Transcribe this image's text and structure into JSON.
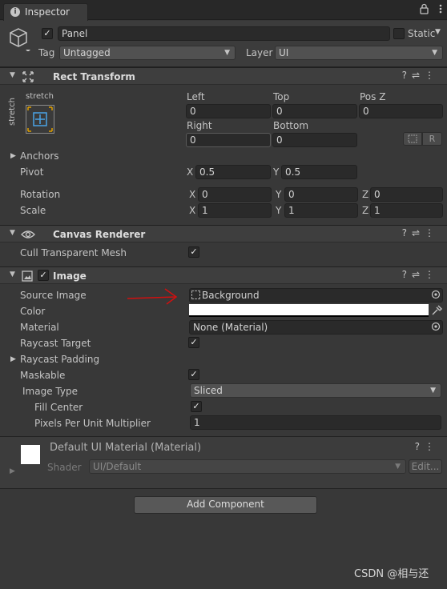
{
  "tab": {
    "label": "Inspector",
    "icons": [
      "lock-icon",
      "menu-icon"
    ]
  },
  "gameobject": {
    "active": true,
    "name": "Panel",
    "static_label": "Static",
    "tag_label": "Tag",
    "tag_value": "Untagged",
    "layer_label": "Layer",
    "layer_value": "UI"
  },
  "rect_transform": {
    "title": "Rect Transform",
    "stretch_top": "stretch",
    "stretch_side": "stretch",
    "left_label": "Left",
    "left_value": "0",
    "top_label": "Top",
    "top_value": "0",
    "posz_label": "Pos Z",
    "posz_value": "0",
    "right_label": "Right",
    "right_value": "0",
    "bottom_label": "Bottom",
    "bottom_value": "0",
    "r_button": "R",
    "anchors_label": "Anchors",
    "pivot_label": "Pivot",
    "pivot_x": "0.5",
    "pivot_y": "0.5",
    "rotation_label": "Rotation",
    "rot_x": "0",
    "rot_y": "0",
    "rot_z": "0",
    "scale_label": "Scale",
    "scale_x": "1",
    "scale_y": "1",
    "scale_z": "1",
    "x": "X",
    "y": "Y",
    "z": "Z"
  },
  "canvas_renderer": {
    "title": "Canvas Renderer",
    "cull_label": "Cull Transparent Mesh",
    "cull_checked": true
  },
  "image": {
    "title": "Image",
    "enabled": true,
    "source_image_label": "Source Image",
    "source_image_value": "Background",
    "color_label": "Color",
    "color_value": "#ffffff",
    "material_label": "Material",
    "material_value": "None (Material)",
    "raycast_target_label": "Raycast Target",
    "raycast_padding_label": "Raycast Padding",
    "maskable_label": "Maskable",
    "image_type_label": "Image Type",
    "image_type_value": "Sliced",
    "fill_center_label": "Fill Center",
    "ppu_label": "Pixels Per Unit Multiplier",
    "ppu_value": "1"
  },
  "material_preview": {
    "title": "Default UI Material (Material)",
    "shader_label": "Shader",
    "shader_value": "UI/Default",
    "edit_button": "Edit..."
  },
  "add_component_button": "Add Component",
  "watermark": "CSDN @相与还",
  "colors": {
    "annotation_arrow": "#d01010",
    "accent_border": "#e0a000",
    "anchor_blue": "#4aa3e6"
  }
}
